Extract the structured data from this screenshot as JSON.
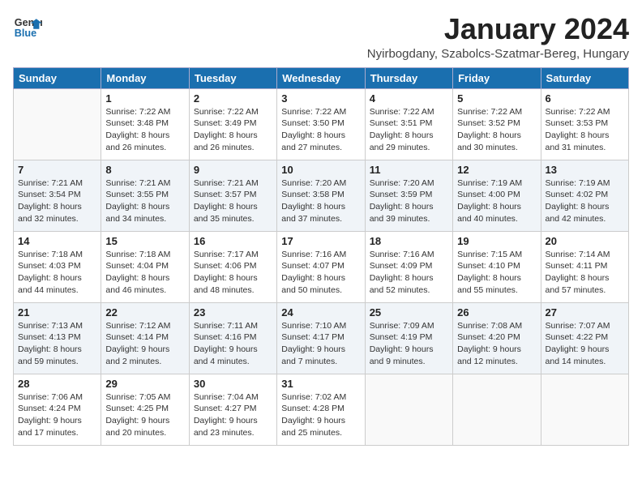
{
  "logo": {
    "line1": "General",
    "line2": "Blue"
  },
  "title": "January 2024",
  "subtitle": "Nyirbogdany, Szabolcs-Szatmar-Bereg, Hungary",
  "days_of_week": [
    "Sunday",
    "Monday",
    "Tuesday",
    "Wednesday",
    "Thursday",
    "Friday",
    "Saturday"
  ],
  "weeks": [
    [
      {
        "day": "",
        "info": ""
      },
      {
        "day": "1",
        "info": "Sunrise: 7:22 AM\nSunset: 3:48 PM\nDaylight: 8 hours\nand 26 minutes."
      },
      {
        "day": "2",
        "info": "Sunrise: 7:22 AM\nSunset: 3:49 PM\nDaylight: 8 hours\nand 26 minutes."
      },
      {
        "day": "3",
        "info": "Sunrise: 7:22 AM\nSunset: 3:50 PM\nDaylight: 8 hours\nand 27 minutes."
      },
      {
        "day": "4",
        "info": "Sunrise: 7:22 AM\nSunset: 3:51 PM\nDaylight: 8 hours\nand 29 minutes."
      },
      {
        "day": "5",
        "info": "Sunrise: 7:22 AM\nSunset: 3:52 PM\nDaylight: 8 hours\nand 30 minutes."
      },
      {
        "day": "6",
        "info": "Sunrise: 7:22 AM\nSunset: 3:53 PM\nDaylight: 8 hours\nand 31 minutes."
      }
    ],
    [
      {
        "day": "7",
        "info": "Sunrise: 7:21 AM\nSunset: 3:54 PM\nDaylight: 8 hours\nand 32 minutes."
      },
      {
        "day": "8",
        "info": "Sunrise: 7:21 AM\nSunset: 3:55 PM\nDaylight: 8 hours\nand 34 minutes."
      },
      {
        "day": "9",
        "info": "Sunrise: 7:21 AM\nSunset: 3:57 PM\nDaylight: 8 hours\nand 35 minutes."
      },
      {
        "day": "10",
        "info": "Sunrise: 7:20 AM\nSunset: 3:58 PM\nDaylight: 8 hours\nand 37 minutes."
      },
      {
        "day": "11",
        "info": "Sunrise: 7:20 AM\nSunset: 3:59 PM\nDaylight: 8 hours\nand 39 minutes."
      },
      {
        "day": "12",
        "info": "Sunrise: 7:19 AM\nSunset: 4:00 PM\nDaylight: 8 hours\nand 40 minutes."
      },
      {
        "day": "13",
        "info": "Sunrise: 7:19 AM\nSunset: 4:02 PM\nDaylight: 8 hours\nand 42 minutes."
      }
    ],
    [
      {
        "day": "14",
        "info": "Sunrise: 7:18 AM\nSunset: 4:03 PM\nDaylight: 8 hours\nand 44 minutes."
      },
      {
        "day": "15",
        "info": "Sunrise: 7:18 AM\nSunset: 4:04 PM\nDaylight: 8 hours\nand 46 minutes."
      },
      {
        "day": "16",
        "info": "Sunrise: 7:17 AM\nSunset: 4:06 PM\nDaylight: 8 hours\nand 48 minutes."
      },
      {
        "day": "17",
        "info": "Sunrise: 7:16 AM\nSunset: 4:07 PM\nDaylight: 8 hours\nand 50 minutes."
      },
      {
        "day": "18",
        "info": "Sunrise: 7:16 AM\nSunset: 4:09 PM\nDaylight: 8 hours\nand 52 minutes."
      },
      {
        "day": "19",
        "info": "Sunrise: 7:15 AM\nSunset: 4:10 PM\nDaylight: 8 hours\nand 55 minutes."
      },
      {
        "day": "20",
        "info": "Sunrise: 7:14 AM\nSunset: 4:11 PM\nDaylight: 8 hours\nand 57 minutes."
      }
    ],
    [
      {
        "day": "21",
        "info": "Sunrise: 7:13 AM\nSunset: 4:13 PM\nDaylight: 8 hours\nand 59 minutes."
      },
      {
        "day": "22",
        "info": "Sunrise: 7:12 AM\nSunset: 4:14 PM\nDaylight: 9 hours\nand 2 minutes."
      },
      {
        "day": "23",
        "info": "Sunrise: 7:11 AM\nSunset: 4:16 PM\nDaylight: 9 hours\nand 4 minutes."
      },
      {
        "day": "24",
        "info": "Sunrise: 7:10 AM\nSunset: 4:17 PM\nDaylight: 9 hours\nand 7 minutes."
      },
      {
        "day": "25",
        "info": "Sunrise: 7:09 AM\nSunset: 4:19 PM\nDaylight: 9 hours\nand 9 minutes."
      },
      {
        "day": "26",
        "info": "Sunrise: 7:08 AM\nSunset: 4:20 PM\nDaylight: 9 hours\nand 12 minutes."
      },
      {
        "day": "27",
        "info": "Sunrise: 7:07 AM\nSunset: 4:22 PM\nDaylight: 9 hours\nand 14 minutes."
      }
    ],
    [
      {
        "day": "28",
        "info": "Sunrise: 7:06 AM\nSunset: 4:24 PM\nDaylight: 9 hours\nand 17 minutes."
      },
      {
        "day": "29",
        "info": "Sunrise: 7:05 AM\nSunset: 4:25 PM\nDaylight: 9 hours\nand 20 minutes."
      },
      {
        "day": "30",
        "info": "Sunrise: 7:04 AM\nSunset: 4:27 PM\nDaylight: 9 hours\nand 23 minutes."
      },
      {
        "day": "31",
        "info": "Sunrise: 7:02 AM\nSunset: 4:28 PM\nDaylight: 9 hours\nand 25 minutes."
      },
      {
        "day": "",
        "info": ""
      },
      {
        "day": "",
        "info": ""
      },
      {
        "day": "",
        "info": ""
      }
    ]
  ]
}
